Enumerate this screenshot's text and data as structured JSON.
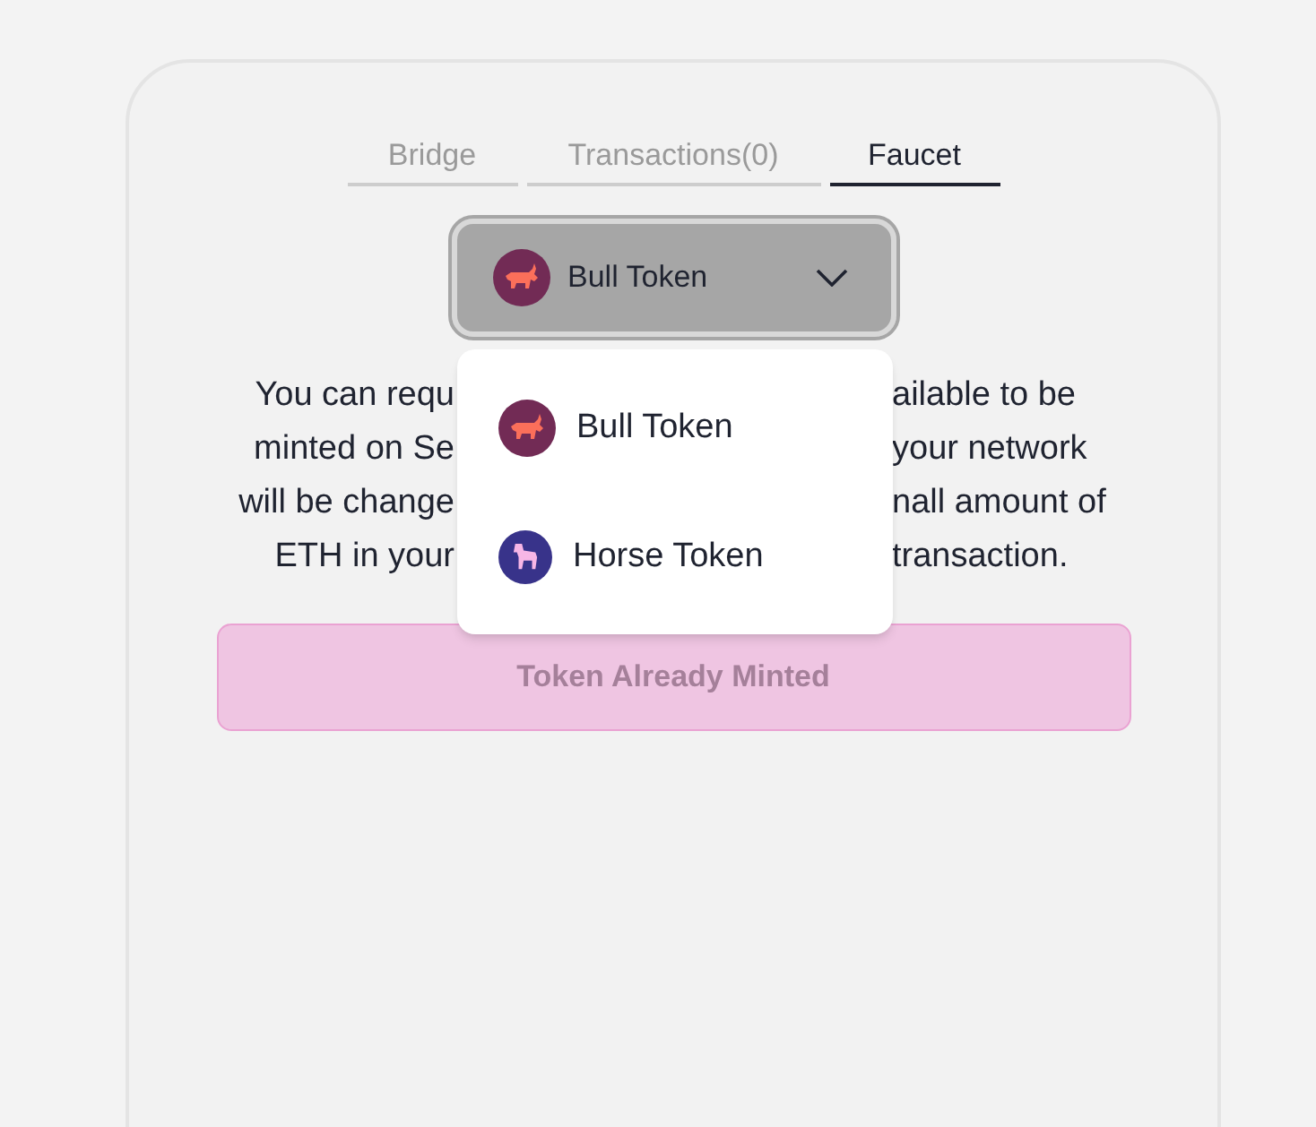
{
  "tabs": [
    {
      "label": "Bridge",
      "selected": false
    },
    {
      "label": "Transactions(0)",
      "selected": false
    },
    {
      "label": "Faucet",
      "selected": true
    }
  ],
  "token_select": {
    "value": "Bull Token",
    "color": "#722b55",
    "expanded": true
  },
  "token_menu": [
    {
      "label": "Bull Token",
      "color": "#722b55"
    },
    {
      "label": "Horse Token",
      "color": "#38338a"
    }
  ],
  "description_lines": [
    {
      "left": "You can requ",
      "right": "ailable to be"
    },
    {
      "left": "minted on Se",
      "right": "your network"
    },
    {
      "left": "will be change",
      "right": "nall amount of"
    },
    {
      "left": "ETH in your",
      "right": "transaction."
    }
  ],
  "mint_button": {
    "label": "Token Already Minted",
    "disabled": true
  }
}
